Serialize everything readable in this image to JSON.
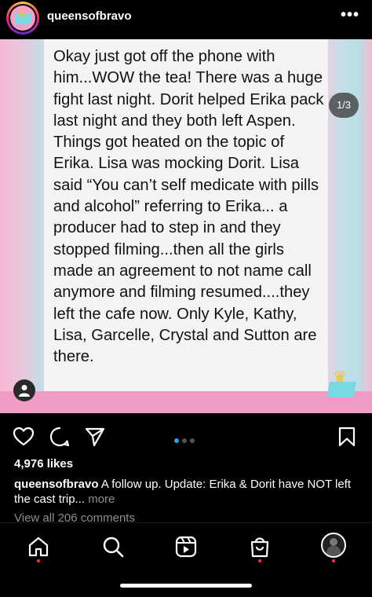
{
  "header": {
    "username": "queensofbravo",
    "more_icon": "more-horizontal-icon"
  },
  "post": {
    "text": "Okay just got off the phone with him...WOW the tea! There was a huge fight last night. Dorit helped Erika pack last night and they both left Aspen. Things got heated on the topic of Erika. Lisa was mocking Dorit. Lisa said “You can’t self medicate with pills and alcohol” referring to Erika... a producer had to step in and they stopped filming...then all the girls made an agreement to not name call anymore and filming resumed....they left the cafe now. Only Kyle, Kathy, Lisa, Garcelle, Crystal and Sutton are there.",
    "counter": "1/3",
    "carousel_current": 1,
    "carousel_total": 3,
    "tag_icon": "user-tag-icon",
    "corner_logo": "crown-logo-icon"
  },
  "actions": {
    "like_icon": "heart-icon",
    "comment_icon": "comment-icon",
    "share_icon": "send-icon",
    "save_icon": "bookmark-icon"
  },
  "likes": "4,976 likes",
  "caption": {
    "username": "queensofbravo",
    "text": " A follow up. Update: Erika & Dorit have NOT left the cast trip... ",
    "more": "more"
  },
  "comments_link": "View all 206 comments",
  "nav": {
    "items": [
      "home-icon",
      "search-icon",
      "reels-icon",
      "shop-icon",
      "profile-avatar"
    ]
  },
  "colors": {
    "accent_blue": "#3897f0",
    "notification_red": "#ff3040",
    "muted_text": "#8e8e8e"
  }
}
